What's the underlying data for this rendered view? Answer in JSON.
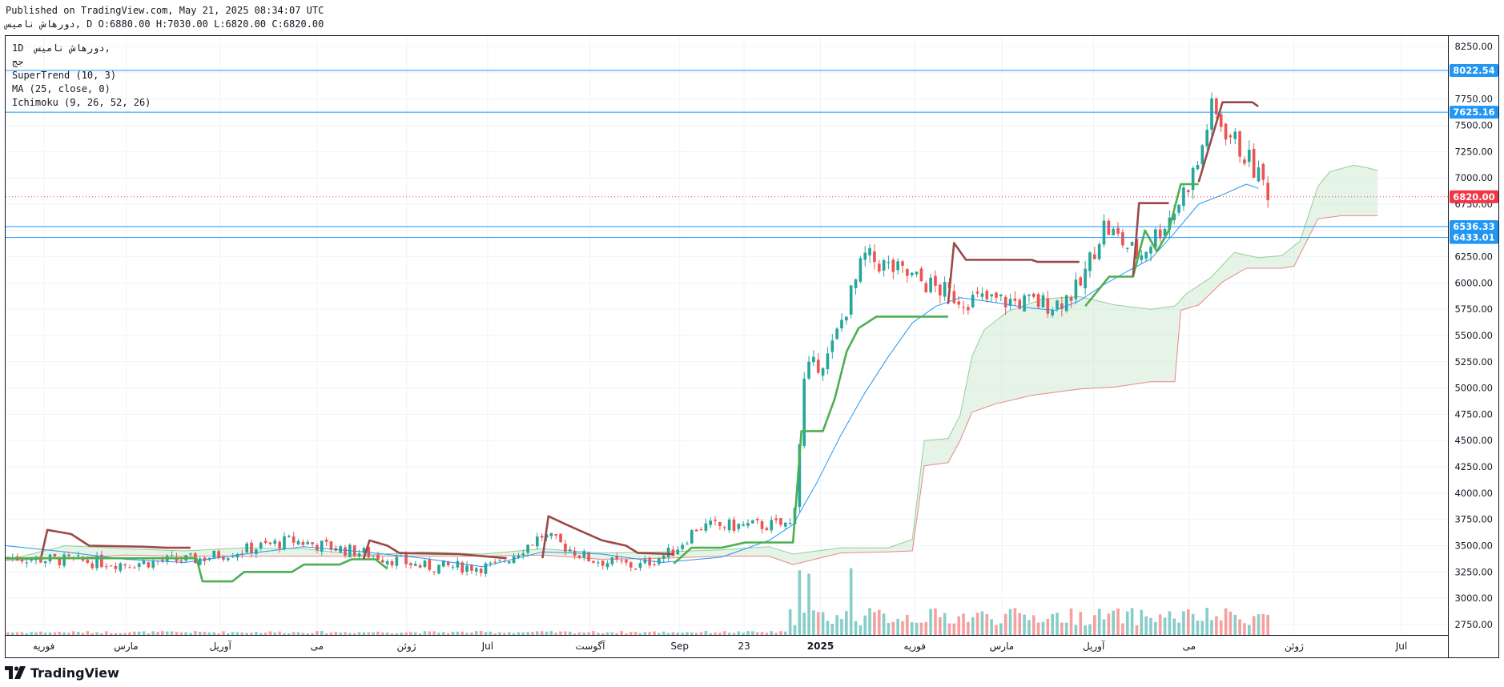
{
  "header": {
    "published": "Published on TradingView.com, May 21, 2025 08:34:07 UTC",
    "ohlc_line": "دورهاش ناميس, D O:6880.00 H:7030.00 L:6820.00 C:6820.00"
  },
  "legend": {
    "symbol_line": "1D  دورهاش ناميس,",
    "exchange": "جج",
    "indicators": [
      "SuperTrend (10, 3)",
      "MA (25, close, 0)",
      "Ichimoku (9, 26, 52, 26)"
    ]
  },
  "brand": {
    "name": "TradingView"
  },
  "colors": {
    "up_candle": "#26a69a",
    "down_candle": "#ef5350",
    "supertrend_up": "#4caf50",
    "supertrend_down": "#9c4848",
    "ma": "#2196f3",
    "hline": "#2196f3",
    "cloud_bull": "#c8e6c9",
    "cloud_bear": "#ffcdd2",
    "price_badge": "#f23645",
    "level_badge": "#2196f3"
  },
  "chart_data": {
    "type": "candlestick",
    "ylim": [
      2650,
      8350
    ],
    "y_ticks": [
      2750,
      3000,
      3250,
      3500,
      3750,
      4000,
      4250,
      4500,
      4750,
      5000,
      5250,
      5500,
      5750,
      6000,
      6250,
      6500,
      6750,
      7000,
      7250,
      7500,
      7750,
      8000,
      8250
    ],
    "y_tick_labels": [
      "2750.00",
      "3000.00",
      "3250.00",
      "3500.00",
      "3750.00",
      "4000.00",
      "4250.00",
      "4500.00",
      "4750.00",
      "5000.00",
      "5250.00",
      "5500.00",
      "5750.00",
      "6000.00",
      "6250.00",
      "6500.00",
      "6750.00",
      "7000.00",
      "7250.00",
      "7500.00",
      "7750.00",
      "8000.00",
      "8250.00"
    ],
    "x_ticks": [
      {
        "label": "فوریه",
        "pos": 0.032
      },
      {
        "label": "مارس",
        "pos": 0.101
      },
      {
        "label": "آوریل",
        "pos": 0.18
      },
      {
        "label": "می",
        "pos": 0.261
      },
      {
        "label": "ژوئن",
        "pos": 0.336
      },
      {
        "label": "Jul",
        "pos": 0.404
      },
      {
        "label": "آگوست",
        "pos": 0.49
      },
      {
        "label": "Sep",
        "pos": 0.565
      },
      {
        "label": "23",
        "pos": 0.619
      },
      {
        "label": "2025",
        "pos": 0.683
      },
      {
        "label": "فوریه",
        "pos": 0.762
      },
      {
        "label": "مارس",
        "pos": 0.835
      },
      {
        "label": "آوریل",
        "pos": 0.912
      },
      {
        "label": "می",
        "pos": 0.992
      },
      {
        "label": "ژوئن",
        "pos": 1.08
      },
      {
        "label": "Jul",
        "pos": 1.17
      }
    ],
    "last_price": 6820,
    "last_price_label": "6820.00",
    "horizontal_levels": [
      {
        "value": 8022.54,
        "label": "8022.54"
      },
      {
        "value": 7625.16,
        "label": "7625.16"
      },
      {
        "value": 6536.33,
        "label": "6536.33"
      },
      {
        "value": 6433.01,
        "label": "6433.01"
      }
    ],
    "price_segments": [
      {
        "start": 0.0,
        "end": 0.1,
        "from": 3390,
        "to": 3330
      },
      {
        "start": 0.1,
        "end": 0.16,
        "from": 3330,
        "to": 3370
      },
      {
        "start": 0.16,
        "end": 0.24,
        "from": 3370,
        "to": 3550
      },
      {
        "start": 0.24,
        "end": 0.3,
        "from": 3550,
        "to": 3430
      },
      {
        "start": 0.3,
        "end": 0.35,
        "from": 3430,
        "to": 3300
      },
      {
        "start": 0.35,
        "end": 0.41,
        "from": 3300,
        "to": 3300
      },
      {
        "start": 0.41,
        "end": 0.45,
        "from": 3300,
        "to": 3600
      },
      {
        "start": 0.45,
        "end": 0.49,
        "from": 3600,
        "to": 3370
      },
      {
        "start": 0.49,
        "end": 0.53,
        "from": 3370,
        "to": 3300
      },
      {
        "start": 0.53,
        "end": 0.56,
        "from": 3300,
        "to": 3450
      },
      {
        "start": 0.56,
        "end": 0.58,
        "from": 3450,
        "to": 3680
      },
      {
        "start": 0.58,
        "end": 0.66,
        "from": 3680,
        "to": 3700
      },
      {
        "start": 0.66,
        "end": 0.67,
        "from": 3700,
        "to": 5150
      },
      {
        "start": 0.67,
        "end": 0.69,
        "from": 5150,
        "to": 5300
      },
      {
        "start": 0.69,
        "end": 0.72,
        "from": 5300,
        "to": 6250
      },
      {
        "start": 0.72,
        "end": 0.73,
        "from": 6250,
        "to": 6200
      },
      {
        "start": 0.73,
        "end": 0.8,
        "from": 6200,
        "to": 5850
      },
      {
        "start": 0.8,
        "end": 0.88,
        "from": 5850,
        "to": 5800
      },
      {
        "start": 0.88,
        "end": 0.9,
        "from": 5800,
        "to": 5950
      },
      {
        "start": 0.9,
        "end": 0.92,
        "from": 5950,
        "to": 6550
      },
      {
        "start": 0.92,
        "end": 0.95,
        "from": 6550,
        "to": 6250
      },
      {
        "start": 0.95,
        "end": 0.98,
        "from": 6250,
        "to": 6700
      },
      {
        "start": 0.98,
        "end": 1.0,
        "from": 6700,
        "to": 7150
      },
      {
        "start": 1.0,
        "end": 1.01,
        "from": 7150,
        "to": 7650
      },
      {
        "start": 1.01,
        "end": 1.04,
        "from": 7650,
        "to": 7200
      },
      {
        "start": 1.04,
        "end": 1.06,
        "from": 7200,
        "to": 6850
      }
    ],
    "volume_spikes": [
      {
        "pos": 0.666,
        "value": 0.95
      },
      {
        "pos": 0.672,
        "value": 0.9
      },
      {
        "pos": 0.71,
        "value": 0.98
      }
    ],
    "supertrend_up": [
      [
        0.0,
        3380
      ],
      [
        0.16,
        3380
      ],
      [
        0.165,
        3160
      ],
      [
        0.19,
        3160
      ],
      [
        0.2,
        3250
      ],
      [
        0.24,
        3250
      ],
      [
        0.25,
        3320
      ],
      [
        0.28,
        3320
      ],
      [
        0.29,
        3370
      ],
      [
        0.31,
        3370
      ],
      [
        0.32,
        3280
      ],
      null,
      [
        0.56,
        3330
      ],
      [
        0.575,
        3480
      ],
      [
        0.6,
        3480
      ],
      [
        0.62,
        3530
      ],
      [
        0.66,
        3530
      ],
      [
        0.667,
        4590
      ],
      [
        0.685,
        4590
      ],
      [
        0.695,
        4900
      ],
      [
        0.705,
        5350
      ],
      [
        0.715,
        5570
      ],
      [
        0.73,
        5680
      ],
      [
        0.79,
        5680
      ],
      null,
      [
        0.905,
        5780
      ],
      [
        0.915,
        5920
      ],
      [
        0.925,
        6060
      ],
      [
        0.945,
        6060
      ],
      [
        0.955,
        6500
      ],
      [
        0.965,
        6300
      ],
      [
        0.975,
        6500
      ],
      [
        0.985,
        6940
      ],
      [
        1.0,
        6940
      ]
    ],
    "supertrend_down": [
      [
        0.03,
        3400
      ],
      [
        0.035,
        3650
      ],
      [
        0.055,
        3610
      ],
      [
        0.07,
        3500
      ],
      [
        0.115,
        3490
      ],
      [
        0.135,
        3480
      ],
      [
        0.155,
        3480
      ],
      null,
      [
        0.3,
        3370
      ],
      [
        0.305,
        3550
      ],
      [
        0.32,
        3500
      ],
      [
        0.33,
        3430
      ],
      [
        0.38,
        3420
      ],
      [
        0.42,
        3380
      ],
      null,
      [
        0.45,
        3380
      ],
      [
        0.455,
        3780
      ],
      [
        0.47,
        3700
      ],
      [
        0.48,
        3650
      ],
      [
        0.5,
        3550
      ],
      [
        0.52,
        3500
      ],
      [
        0.53,
        3430
      ],
      [
        0.56,
        3420
      ],
      null,
      [
        0.79,
        5800
      ],
      [
        0.795,
        6380
      ],
      [
        0.805,
        6220
      ],
      [
        0.86,
        6220
      ],
      [
        0.865,
        6200
      ],
      [
        0.9,
        6200
      ],
      null,
      [
        0.945,
        6060
      ],
      [
        0.95,
        6760
      ],
      [
        0.975,
        6760
      ],
      null,
      [
        1.0,
        6960
      ],
      [
        1.02,
        7720
      ],
      [
        1.045,
        7720
      ],
      [
        1.05,
        7680
      ]
    ],
    "ma_line": [
      [
        0.0,
        3500
      ],
      [
        0.05,
        3440
      ],
      [
        0.1,
        3370
      ],
      [
        0.15,
        3340
      ],
      [
        0.2,
        3420
      ],
      [
        0.25,
        3490
      ],
      [
        0.3,
        3440
      ],
      [
        0.35,
        3380
      ],
      [
        0.4,
        3300
      ],
      [
        0.45,
        3440
      ],
      [
        0.5,
        3420
      ],
      [
        0.55,
        3340
      ],
      [
        0.6,
        3390
      ],
      [
        0.64,
        3550
      ],
      [
        0.66,
        3700
      ],
      [
        0.68,
        4100
      ],
      [
        0.7,
        4550
      ],
      [
        0.72,
        4950
      ],
      [
        0.74,
        5300
      ],
      [
        0.76,
        5620
      ],
      [
        0.78,
        5780
      ],
      [
        0.8,
        5860
      ],
      [
        0.82,
        5830
      ],
      [
        0.86,
        5760
      ],
      [
        0.88,
        5740
      ],
      [
        0.9,
        5830
      ],
      [
        0.92,
        5980
      ],
      [
        0.94,
        6110
      ],
      [
        0.96,
        6230
      ],
      [
        0.98,
        6480
      ],
      [
        1.0,
        6750
      ],
      [
        1.02,
        6840
      ],
      [
        1.04,
        6940
      ],
      [
        1.05,
        6900
      ]
    ],
    "ichimoku_span_a": [
      [
        0.0,
        3360
      ],
      [
        0.05,
        3500
      ],
      [
        0.1,
        3470
      ],
      [
        0.15,
        3450
      ],
      [
        0.2,
        3480
      ],
      [
        0.25,
        3470
      ],
      [
        0.3,
        3410
      ],
      [
        0.35,
        3440
      ],
      [
        0.4,
        3420
      ],
      [
        0.45,
        3470
      ],
      [
        0.5,
        3430
      ],
      [
        0.55,
        3440
      ],
      [
        0.6,
        3460
      ],
      [
        0.64,
        3490
      ],
      [
        0.66,
        3420
      ],
      [
        0.7,
        3480
      ],
      [
        0.74,
        3480
      ],
      [
        0.76,
        3560
      ],
      [
        0.77,
        4500
      ],
      [
        0.79,
        4520
      ],
      [
        0.8,
        4740
      ],
      [
        0.81,
        5300
      ],
      [
        0.82,
        5550
      ],
      [
        0.84,
        5730
      ],
      [
        0.87,
        5850
      ],
      [
        0.9,
        5870
      ],
      [
        0.93,
        5790
      ],
      [
        0.96,
        5750
      ],
      [
        0.98,
        5780
      ],
      [
        0.99,
        5900
      ],
      [
        1.01,
        6050
      ],
      [
        1.03,
        6290
      ],
      [
        1.05,
        6240
      ],
      [
        1.07,
        6260
      ],
      [
        1.085,
        6400
      ],
      [
        1.1,
        6920
      ],
      [
        1.11,
        7060
      ],
      [
        1.13,
        7120
      ],
      [
        1.14,
        7100
      ],
      [
        1.15,
        7070
      ]
    ],
    "ichimoku_span_b": [
      [
        0.0,
        3360
      ],
      [
        0.05,
        3380
      ],
      [
        0.1,
        3410
      ],
      [
        0.15,
        3400
      ],
      [
        0.2,
        3400
      ],
      [
        0.25,
        3400
      ],
      [
        0.3,
        3400
      ],
      [
        0.35,
        3400
      ],
      [
        0.4,
        3400
      ],
      [
        0.45,
        3410
      ],
      [
        0.5,
        3370
      ],
      [
        0.55,
        3380
      ],
      [
        0.6,
        3400
      ],
      [
        0.64,
        3400
      ],
      [
        0.66,
        3320
      ],
      [
        0.7,
        3430
      ],
      [
        0.74,
        3440
      ],
      [
        0.76,
        3450
      ],
      [
        0.77,
        4260
      ],
      [
        0.79,
        4290
      ],
      [
        0.8,
        4500
      ],
      [
        0.81,
        4770
      ],
      [
        0.83,
        4850
      ],
      [
        0.86,
        4930
      ],
      [
        0.9,
        4990
      ],
      [
        0.93,
        5010
      ],
      [
        0.96,
        5060
      ],
      [
        0.98,
        5060
      ],
      [
        0.985,
        5740
      ],
      [
        1.0,
        5790
      ],
      [
        1.02,
        6010
      ],
      [
        1.04,
        6140
      ],
      [
        1.07,
        6140
      ],
      [
        1.08,
        6160
      ],
      [
        1.1,
        6610
      ],
      [
        1.12,
        6640
      ],
      [
        1.15,
        6640
      ]
    ]
  }
}
